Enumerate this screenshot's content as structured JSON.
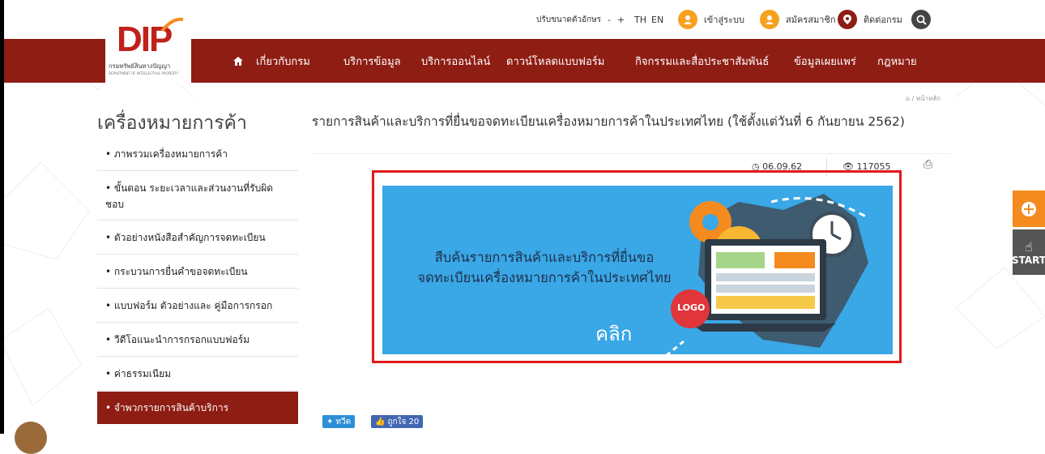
{
  "header": {
    "logo_text": "DIP",
    "logo_subtitle": "กรมทรัพย์สินทางปัญญา",
    "logo_subtitle_en": "DEPARTMENT OF INTELLECTUAL PROPERTY",
    "font_size_label": "ปรับขนาดตัวอักษร",
    "font_minus": "-",
    "font_plus": "+",
    "lang_th": "TH",
    "lang_en": "EN",
    "login_label": "เข้าสู่ระบบ",
    "register_label": "สมัครสมาชิก",
    "contact_label": "ติดต่อกรม"
  },
  "nav": {
    "items": [
      "เกี่ยวกับกรม",
      "บริการข้อมูล",
      "บริการออนไลน์",
      "ดาวน์โหลดแบบฟอร์ม",
      "กิจกรรมและสื่อประชาสัมพันธ์",
      "ข้อมูลเผยแพร่",
      "กฎหมาย"
    ]
  },
  "breadcrumb": {
    "home": "หน้าหลัก"
  },
  "sidebar": {
    "title": "เครื่องหมายการค้า",
    "items": [
      "• ภาพรวมเครื่องหมายการค้า",
      "• ขั้นตอน ระยะเวลาและส่วนงานที่รับผิดชอบ",
      "• ตัวอย่างหนังสือสำคัญการจดทะเบียน",
      "• กระบวนการยื่นคำขอจดทะเบียน",
      "• แบบฟอร์ม ตัวอย่างและ คู่มือการกรอก",
      "• วีดีโอแนะนำการกรอกแบบฟอร์ม",
      "• ค่าธรรมเนียม",
      "• จำพวกรายการสินค้าบริการ"
    ],
    "active_index": 7
  },
  "article": {
    "title": "รายการสินค้าและบริการที่ยื่นขอจดทะเบียนเครื่องหมายการค้าในประเทศไทย (ใช้ตั้งแต่วันที่ 6 กันยายน 2562)",
    "date": "06.09.62",
    "views": "117055",
    "banner_line1": "สืบค้นรายการสินค้าและบริการที่ยื่นขอ",
    "banner_line2": "จดทะเบียนเครื่องหมายการค้าในประเทศไทย",
    "banner_logo": "LOGO",
    "banner_click": "คลิก"
  },
  "social": {
    "tweet": "ทวีต",
    "like": "ถูกใจ 20"
  },
  "float": {
    "start": "START"
  },
  "colors": {
    "nav_red": "#8e1d14",
    "accent_orange": "#f58a1f",
    "banner_blue": "#3aa7e6",
    "highlight_red": "#e0191b"
  }
}
